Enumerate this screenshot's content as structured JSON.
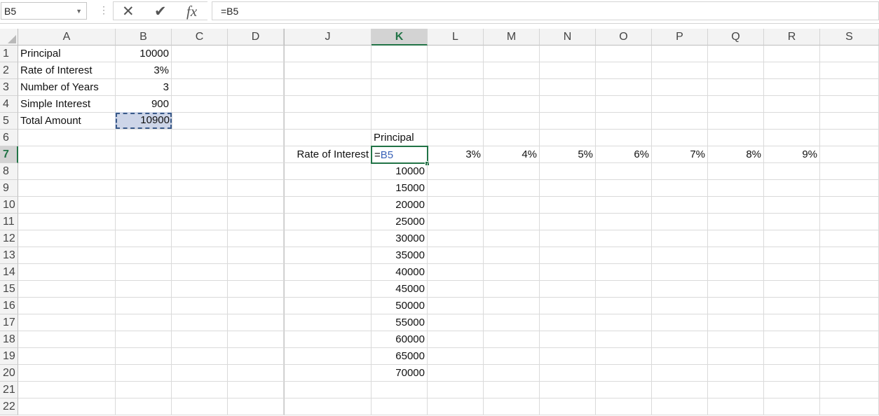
{
  "formula_bar": {
    "name_box": "B5",
    "formula": "=B5",
    "cancel_icon": "close-icon",
    "enter_icon": "check-icon",
    "fx_label": "fx"
  },
  "columns": [
    "A",
    "B",
    "C",
    "D",
    "J",
    "K",
    "L",
    "M",
    "N",
    "O",
    "P",
    "Q",
    "R",
    "S"
  ],
  "rows": [
    "1",
    "2",
    "3",
    "4",
    "5",
    "6",
    "7",
    "8",
    "9",
    "10",
    "11",
    "12",
    "13",
    "14",
    "15",
    "16",
    "17",
    "18",
    "19",
    "20",
    "21",
    "22"
  ],
  "selected_column": "K",
  "selected_row": "7",
  "cells": {
    "A1": "Principal",
    "B1": "10000",
    "A2": "Rate of Interest",
    "B2": "3%",
    "A3": "Number of Years",
    "B3": "3",
    "A4": "Simple Interest",
    "B4": "900",
    "A5": "Total Amount",
    "B5": "10900",
    "K6": "Principal",
    "J7": "Rate of Interest",
    "K7_eq": "=",
    "K7_ref": "B5",
    "L7": "3%",
    "M7": "4%",
    "N7": "5%",
    "O7": "6%",
    "P7": "7%",
    "Q7": "8%",
    "R7": "9%",
    "K8": "10000",
    "K9": "15000",
    "K10": "20000",
    "K11": "25000",
    "K12": "30000",
    "K13": "35000",
    "K14": "40000",
    "K15": "45000",
    "K16": "50000",
    "K17": "55000",
    "K18": "60000",
    "K19": "65000",
    "K20": "70000"
  },
  "colors": {
    "accent": "#217346",
    "copy_marquee": "#3a5a8a",
    "ref_text": "#3a62b8"
  }
}
